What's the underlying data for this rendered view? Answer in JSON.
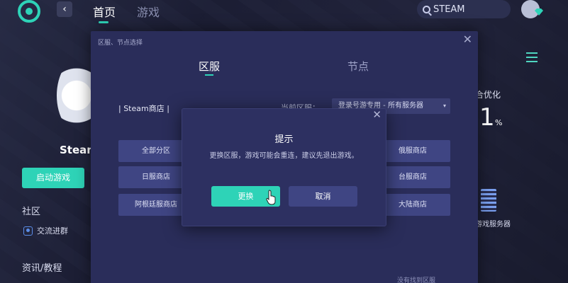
{
  "topbar": {
    "back_glyph": "‹",
    "nav_home": "首页",
    "nav_games": "游戏",
    "search_text": "STEAM",
    "accent_color": "#2ed3b7"
  },
  "left_panel": {
    "game_title": "Steam",
    "start_button": "启动游戏",
    "community_heading": "社区",
    "community_link": "交流进群",
    "guides_heading": "资讯/教程"
  },
  "right_panel": {
    "optimize_label": "合优化",
    "optimize_value": "1",
    "optimize_unit": "%",
    "server_label": "游戏服务器"
  },
  "region_dialog": {
    "title": "区服、节点选择",
    "close_glyph": "✕",
    "tab_region": "区服",
    "tab_node": "节点",
    "store_label": "| Steam商店 |",
    "current_label": "当前区服：",
    "select_value": "登录号游专用 - 所有服务器",
    "select_caret": "▾",
    "buttons_left": [
      "全部分区",
      "日服商店",
      "阿根廷服商店"
    ],
    "buttons_right": [
      "俄服商店",
      "台服商店",
      "大陆商店"
    ],
    "not_found": "没有找到区服"
  },
  "prompt": {
    "close_glyph": "✕",
    "title": "提示",
    "message": "更换区服，游戏可能会重连，建议先退出游戏。",
    "confirm": "更换",
    "cancel": "取消"
  }
}
